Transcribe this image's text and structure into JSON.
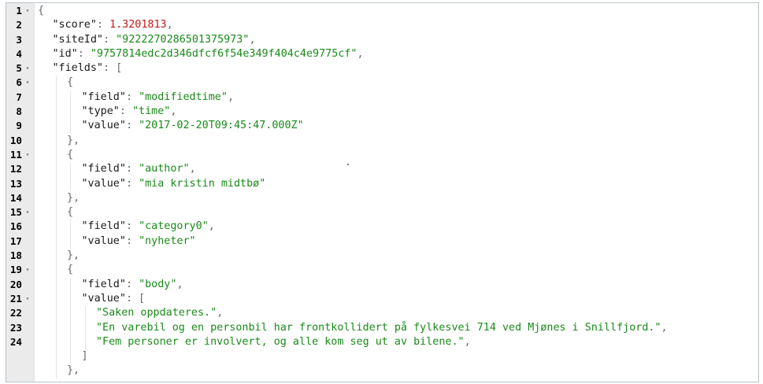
{
  "editor": {
    "lines": [
      {
        "n": "1",
        "fold": true,
        "indent": 0,
        "parts": [
          {
            "t": "p",
            "v": "{"
          }
        ]
      },
      {
        "n": "2",
        "fold": false,
        "indent": 1,
        "parts": [
          {
            "t": "k",
            "v": "\"score\""
          },
          {
            "t": "p",
            "v": ": "
          },
          {
            "t": "n",
            "v": "1.3201813"
          },
          {
            "t": "p",
            "v": ","
          }
        ]
      },
      {
        "n": "3",
        "fold": false,
        "indent": 1,
        "parts": [
          {
            "t": "k",
            "v": "\"siteId\""
          },
          {
            "t": "p",
            "v": ": "
          },
          {
            "t": "s",
            "v": "\"9222270286501375973\""
          },
          {
            "t": "p",
            "v": ","
          }
        ]
      },
      {
        "n": "4",
        "fold": false,
        "indent": 1,
        "parts": [
          {
            "t": "k",
            "v": "\"id\""
          },
          {
            "t": "p",
            "v": ": "
          },
          {
            "t": "s",
            "v": "\"9757814edc2d346dfcf6f54e349f404c4e9775cf\""
          },
          {
            "t": "p",
            "v": ","
          }
        ]
      },
      {
        "n": "5",
        "fold": true,
        "indent": 1,
        "parts": [
          {
            "t": "k",
            "v": "\"fields\""
          },
          {
            "t": "p",
            "v": ": ["
          }
        ]
      },
      {
        "n": "6",
        "fold": true,
        "indent": 2,
        "parts": [
          {
            "t": "p",
            "v": "{"
          }
        ]
      },
      {
        "n": "7",
        "fold": false,
        "indent": 3,
        "parts": [
          {
            "t": "k",
            "v": "\"field\""
          },
          {
            "t": "p",
            "v": ": "
          },
          {
            "t": "s",
            "v": "\"modifiedtime\""
          },
          {
            "t": "p",
            "v": ","
          }
        ]
      },
      {
        "n": "8",
        "fold": false,
        "indent": 3,
        "parts": [
          {
            "t": "k",
            "v": "\"type\""
          },
          {
            "t": "p",
            "v": ": "
          },
          {
            "t": "s",
            "v": "\"time\""
          },
          {
            "t": "p",
            "v": ","
          }
        ]
      },
      {
        "n": "9",
        "fold": false,
        "indent": 3,
        "parts": [
          {
            "t": "k",
            "v": "\"value\""
          },
          {
            "t": "p",
            "v": ": "
          },
          {
            "t": "s",
            "v": "\"2017-02-20T09:45:47.000Z\""
          }
        ]
      },
      {
        "n": "10",
        "fold": false,
        "indent": 2,
        "parts": [
          {
            "t": "p",
            "v": "},"
          }
        ]
      },
      {
        "n": "11",
        "fold": true,
        "indent": 2,
        "parts": [
          {
            "t": "p",
            "v": "{"
          }
        ]
      },
      {
        "n": "12",
        "fold": false,
        "indent": 3,
        "parts": [
          {
            "t": "k",
            "v": "\"field\""
          },
          {
            "t": "p",
            "v": ": "
          },
          {
            "t": "s",
            "v": "\"author\""
          },
          {
            "t": "p",
            "v": ","
          }
        ]
      },
      {
        "n": "13",
        "fold": false,
        "indent": 3,
        "parts": [
          {
            "t": "k",
            "v": "\"value\""
          },
          {
            "t": "p",
            "v": ": "
          },
          {
            "t": "s",
            "v": "\"mia kristin midtbø\""
          }
        ]
      },
      {
        "n": "14",
        "fold": false,
        "indent": 2,
        "parts": [
          {
            "t": "p",
            "v": "},"
          }
        ]
      },
      {
        "n": "15",
        "fold": true,
        "indent": 2,
        "parts": [
          {
            "t": "p",
            "v": "{"
          }
        ]
      },
      {
        "n": "16",
        "fold": false,
        "indent": 3,
        "parts": [
          {
            "t": "k",
            "v": "\"field\""
          },
          {
            "t": "p",
            "v": ": "
          },
          {
            "t": "s",
            "v": "\"category0\""
          },
          {
            "t": "p",
            "v": ","
          }
        ]
      },
      {
        "n": "17",
        "fold": false,
        "indent": 3,
        "parts": [
          {
            "t": "k",
            "v": "\"value\""
          },
          {
            "t": "p",
            "v": ": "
          },
          {
            "t": "s",
            "v": "\"nyheter\""
          }
        ]
      },
      {
        "n": "18",
        "fold": false,
        "indent": 2,
        "parts": [
          {
            "t": "p",
            "v": "},"
          }
        ]
      },
      {
        "n": "19",
        "fold": true,
        "indent": 2,
        "parts": [
          {
            "t": "p",
            "v": "{"
          }
        ]
      },
      {
        "n": "20",
        "fold": false,
        "indent": 3,
        "parts": [
          {
            "t": "k",
            "v": "\"field\""
          },
          {
            "t": "p",
            "v": ": "
          },
          {
            "t": "s",
            "v": "\"body\""
          },
          {
            "t": "p",
            "v": ","
          }
        ]
      },
      {
        "n": "21",
        "fold": true,
        "indent": 3,
        "parts": [
          {
            "t": "k",
            "v": "\"value\""
          },
          {
            "t": "p",
            "v": ": ["
          }
        ]
      },
      {
        "n": "22",
        "fold": false,
        "indent": 4,
        "parts": [
          {
            "t": "s",
            "v": "\"Saken oppdateres.\""
          },
          {
            "t": "p",
            "v": ","
          }
        ]
      },
      {
        "n": "23",
        "fold": false,
        "indent": 4,
        "parts": [
          {
            "t": "s",
            "v": "\"En varebil og en personbil har frontkollidert på fylkesvei 714 ved Mjønes i Snillfjord.\""
          },
          {
            "t": "p",
            "v": ","
          }
        ]
      },
      {
        "n": "24",
        "fold": false,
        "indent": 4,
        "parts": [
          {
            "t": "s",
            "v": "\"Fem personer er involvert, og alle kom seg ut av bilene.\""
          },
          {
            "t": "p",
            "v": ","
          }
        ]
      },
      {
        "n": "",
        "fold": false,
        "indent": 3,
        "parts": [
          {
            "t": "p",
            "v": "]"
          }
        ]
      },
      {
        "n": "",
        "fold": false,
        "indent": 2,
        "parts": [
          {
            "t": "p",
            "v": "},"
          }
        ]
      }
    ]
  },
  "icons": {
    "fold": "fold-arrow-icon"
  },
  "colors": {
    "key": "#1a1a1a",
    "string": "#1a8a1a",
    "number": "#c41a16",
    "punctuation": "#6a6a6a",
    "gutter_bg": "#ebebeb"
  }
}
